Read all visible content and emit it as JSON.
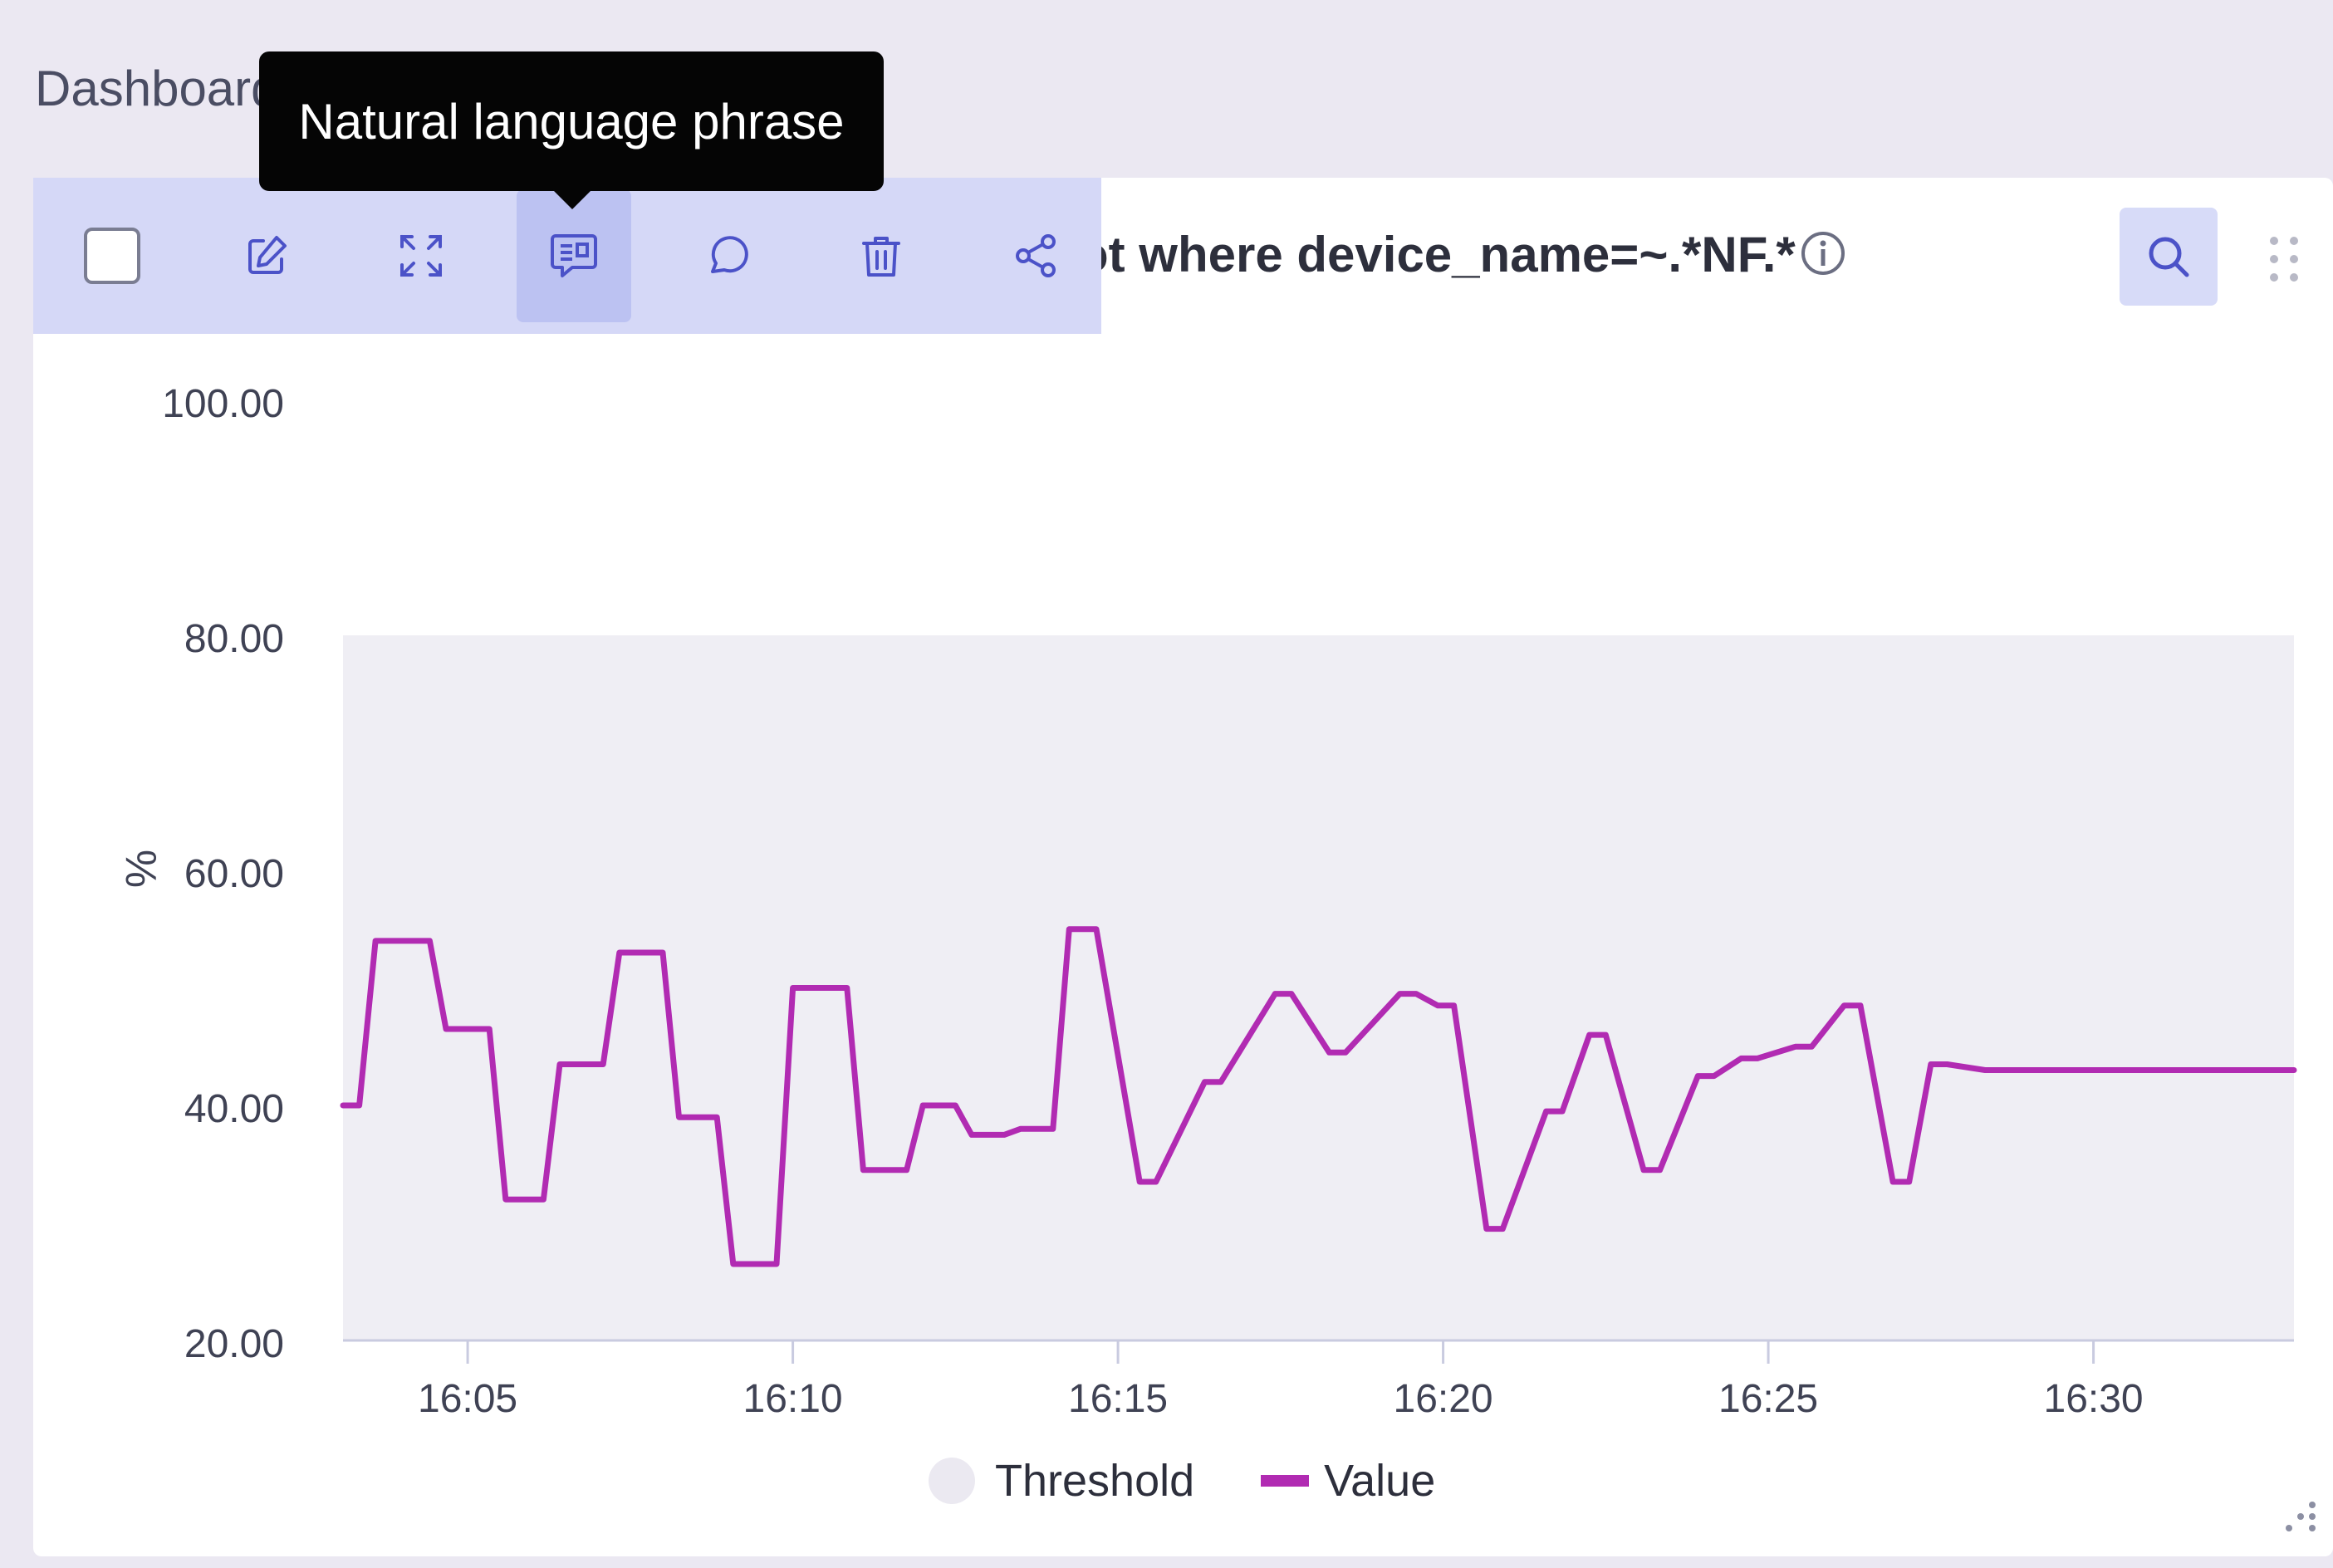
{
  "breadcrumb": {
    "label": "Dashboard"
  },
  "panel": {
    "title": "ot where device_name=~.*NF.*"
  },
  "tooltip": {
    "text": "Natural language phrase"
  },
  "toolbar": {
    "buttons": [
      {
        "name": "select-checkbox",
        "icon": "checkbox"
      },
      {
        "name": "edit-button",
        "icon": "edit-icon"
      },
      {
        "name": "expand-button",
        "icon": "expand-icon"
      },
      {
        "name": "natural-language-button",
        "icon": "natural-language-icon",
        "active": true
      },
      {
        "name": "comment-button",
        "icon": "comment-icon"
      },
      {
        "name": "delete-button",
        "icon": "trash-icon"
      },
      {
        "name": "share-button",
        "icon": "share-icon"
      }
    ]
  },
  "colors": {
    "series": "#b12bb2",
    "threshold_band": "#efeef4",
    "toolbar_bg": "#d5d8f7",
    "icon": "#4b52c8"
  },
  "chart_data": {
    "type": "line",
    "title": "ot where device_name=~.*NF.*",
    "ylabel": "%",
    "xlabel": "",
    "ylim": [
      20,
      100
    ],
    "y_ticks": [
      "100.00",
      "80.00",
      "60.00",
      "40.00",
      "20.00"
    ],
    "x_ticks": [
      "16:05",
      "16:10",
      "16:15",
      "16:20",
      "16:25",
      "16:30"
    ],
    "x_range": [
      "16:03:05",
      "16:33:05"
    ],
    "grid": false,
    "legend": "bottom-center",
    "threshold": {
      "name": "Threshold",
      "from": 20,
      "to": 80
    },
    "series": [
      {
        "name": "Value",
        "x": [
          "16:03:05",
          "16:03:20",
          "16:03:35",
          "16:04:25",
          "16:04:40",
          "16:05:20",
          "16:05:35",
          "16:06:10",
          "16:06:25",
          "16:07:05",
          "16:07:20",
          "16:08:00",
          "16:08:15",
          "16:08:50",
          "16:09:05",
          "16:09:45",
          "16:10:00",
          "16:10:50",
          "16:11:05",
          "16:11:45",
          "16:12:00",
          "16:12:30",
          "16:12:45",
          "16:13:15",
          "16:13:30",
          "16:14:00",
          "16:14:15",
          "16:14:40",
          "16:15:20",
          "16:15:35",
          "16:16:20",
          "16:16:35",
          "16:17:25",
          "16:17:40",
          "16:18:15",
          "16:18:30",
          "16:19:20",
          "16:19:35",
          "16:19:55",
          "16:20:10",
          "16:20:40",
          "16:20:55",
          "16:21:35",
          "16:21:50",
          "16:22:15",
          "16:22:30",
          "16:23:05",
          "16:23:20",
          "16:23:55",
          "16:24:10",
          "16:24:35",
          "16:24:50",
          "16:25:25",
          "16:25:40",
          "16:26:10",
          "16:26:25",
          "16:26:55",
          "16:27:10",
          "16:27:30",
          "16:27:45",
          "16:28:20",
          "16:28:35",
          "16:29:15",
          "16:29:30",
          "16:30:10",
          "16:30:25",
          "16:30:55",
          "16:31:10",
          "16:31:45",
          "16:32:00",
          "16:32:25",
          "16:32:40",
          "16:33:05"
        ],
        "values": [
          40,
          40,
          54,
          54,
          46.5,
          46.5,
          32,
          32,
          43.5,
          43.5,
          53,
          53,
          39,
          39,
          26.5,
          26.5,
          50,
          50,
          34.5,
          34.5,
          40,
          40,
          37.5,
          37.5,
          38,
          38,
          55,
          55,
          33.5,
          33.5,
          42,
          42,
          49.5,
          49.5,
          44.5,
          44.5,
          49.5,
          49.5,
          48.5,
          48.5,
          29.5,
          29.5,
          39.5,
          39.5,
          46,
          46,
          34.5,
          34.5,
          42.5,
          42.5,
          44,
          44,
          45,
          45,
          48.5,
          48.5,
          33.5,
          33.5,
          43.5,
          43.5,
          43,
          43,
          43,
          43,
          43,
          43,
          43,
          43,
          43,
          43,
          43,
          43,
          43
        ]
      }
    ]
  },
  "legend": {
    "threshold_label": "Threshold",
    "value_label": "Value"
  }
}
